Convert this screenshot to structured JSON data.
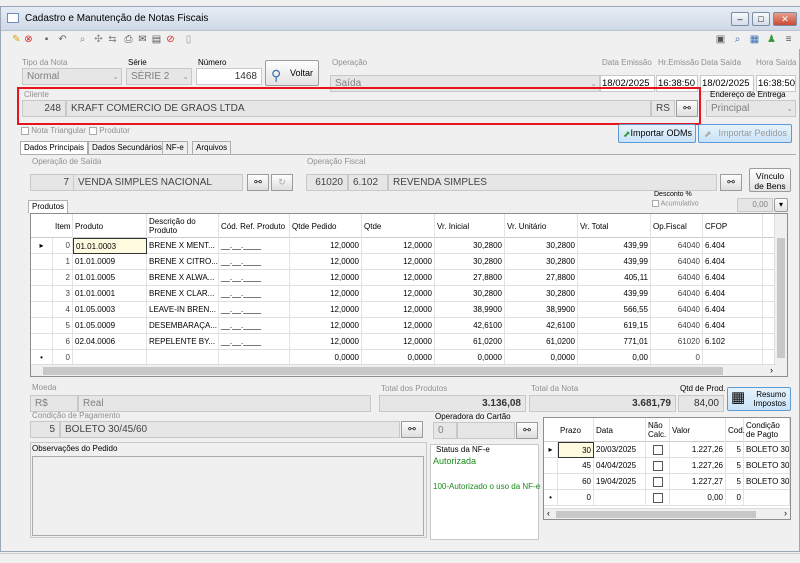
{
  "window": {
    "title": "Cadastro e Manutenção de Notas Fiscais",
    "min": "–",
    "max": "□",
    "close": "✕"
  },
  "header": {
    "tipo_label": "Tipo da Nota",
    "tipo_value": "Normal",
    "serie_label": "Série",
    "serie_value": "SÉRIE 2",
    "numero_label": "Número",
    "numero_value": "1468",
    "voltar_label": "Voltar",
    "operacao_label": "Operação",
    "operacao_value": "Saída",
    "data_emissao_label": "Data Emissão",
    "data_emissao_value": "18/02/2025",
    "hr_emissao_label": "Hr.Emissão",
    "hr_emissao_value": "16:38:50",
    "data_saida_label": "Data Saída",
    "data_saida_value": "18/02/2025",
    "hora_saida_label": "Hora Saída",
    "hora_saida_value": "16:38:50"
  },
  "cliente": {
    "label": "Cliente",
    "codigo": "248",
    "nome": "KRAFT COMERCIO DE GRAOS LTDA",
    "uf": "RS"
  },
  "entrega": {
    "label": "Endereço de Entrega",
    "value": "Principal"
  },
  "flags": {
    "triangular": "Nota Triangular",
    "produtor": "Produtor"
  },
  "buttons": {
    "importar_odms": "Importar ODMs",
    "importar_pedidos": "Importar Pedidos",
    "vinculo": "Vínculo de Bens",
    "resumo": "Resumo Impostos"
  },
  "tabs": [
    "Dados Principais",
    "Dados Secundários",
    "NF-e",
    "Arquivos"
  ],
  "op_saida": {
    "label": "Operação de Saída",
    "codigo": "7",
    "nome": "VENDA SIMPLES NACIONAL"
  },
  "op_fiscal": {
    "label": "Operação Fiscal",
    "codigo": "61020",
    "cfop": "6.102",
    "nome": "REVENDA SIMPLES"
  },
  "produtos_tab": "Produtos",
  "desconto": {
    "label": "Desconto %",
    "acumulativo": "Acumulativo",
    "value": "0,00"
  },
  "grid": {
    "headers": [
      "Item",
      "Produto",
      "Descrição do Produto",
      "Cód. Ref. Produto",
      "Qtde Pedido",
      "Qtde",
      "Vr. Inicial",
      "Vr. Unitário",
      "Vr. Total",
      "Op.Fiscal",
      "CFOP"
    ],
    "rows": [
      [
        "0",
        "01.01.0003",
        "BRENE X MENT...",
        "__.__.____",
        "12,0000",
        "12,0000",
        "30,2800",
        "30,2800",
        "439,99",
        "64040",
        "6.404"
      ],
      [
        "1",
        "01.01.0009",
        "BRENE X CITRO...",
        "__.__.____",
        "12,0000",
        "12,0000",
        "30,2800",
        "30,2800",
        "439,99",
        "64040",
        "6.404"
      ],
      [
        "2",
        "01.01.0005",
        "BRENE X ALWA...",
        "__.__.____",
        "12,0000",
        "12,0000",
        "27,8800",
        "27,8800",
        "405,11",
        "64040",
        "6.404"
      ],
      [
        "3",
        "01.01.0001",
        "BRENE X CLAR...",
        "__.__.____",
        "12,0000",
        "12,0000",
        "30,2800",
        "30,2800",
        "439,99",
        "64040",
        "6.404"
      ],
      [
        "4",
        "01.05.0003",
        "LEAVE-IN BREN...",
        "__.__.____",
        "12,0000",
        "12,0000",
        "38,9900",
        "38,9900",
        "566,55",
        "64040",
        "6.404"
      ],
      [
        "5",
        "01.05.0009",
        "DESEMBARAÇA...",
        "__.__.____",
        "12,0000",
        "12,0000",
        "42,6100",
        "42,6100",
        "619,15",
        "64040",
        "6.404"
      ],
      [
        "6",
        "02.04.0006",
        "REPELENTE BY...",
        "__.__.____",
        "12,0000",
        "12,0000",
        "61,0200",
        "61,0200",
        "771,01",
        "61020",
        "6.102"
      ],
      [
        "0",
        "",
        "",
        "",
        "0,0000",
        "0,0000",
        "0,0000",
        "0,0000",
        "0,00",
        "0",
        ""
      ]
    ]
  },
  "moeda": {
    "label": "Moeda",
    "sigla": "R$",
    "nome": "Real"
  },
  "totais": {
    "produtos_label": "Total dos Produtos",
    "produtos_value": "3.136,08",
    "nota_label": "Total da Nota",
    "nota_value": "3.681,79",
    "qtd_label": "Qtd de Prod.",
    "qtd_value": "84,00"
  },
  "pagamento": {
    "label": "Condição de Pagamento",
    "codigo": "5",
    "nome": "BOLETO 30/45/60"
  },
  "cartao": {
    "label": "Operadora do Cartão",
    "codigo": "0"
  },
  "obs_label": "Observações do Pedido",
  "nfe": {
    "label": "Status da NF-e",
    "status": "Autorizada",
    "mensagem": "100-Autorizado o uso da NF-e"
  },
  "parcelas": {
    "headers": [
      "Prazo",
      "Data",
      "Não Calc.",
      "Valor",
      "Cod.",
      "Condição de Pagto"
    ],
    "rows": [
      [
        "30",
        "20/03/2025",
        "",
        "1.227,26",
        "5",
        "BOLETO 30"
      ],
      [
        "45",
        "04/04/2025",
        "",
        "1.227,26",
        "5",
        "BOLETO 30"
      ],
      [
        "60",
        "19/04/2025",
        "",
        "1.227,27",
        "5",
        "BOLETO 30"
      ],
      [
        "0",
        "",
        "",
        "0,00",
        "0",
        ""
      ]
    ]
  },
  "colors": {
    "highlight": "#e8141c",
    "accent": "#5d9ad6",
    "nfe_green": "#1a8a1a"
  }
}
